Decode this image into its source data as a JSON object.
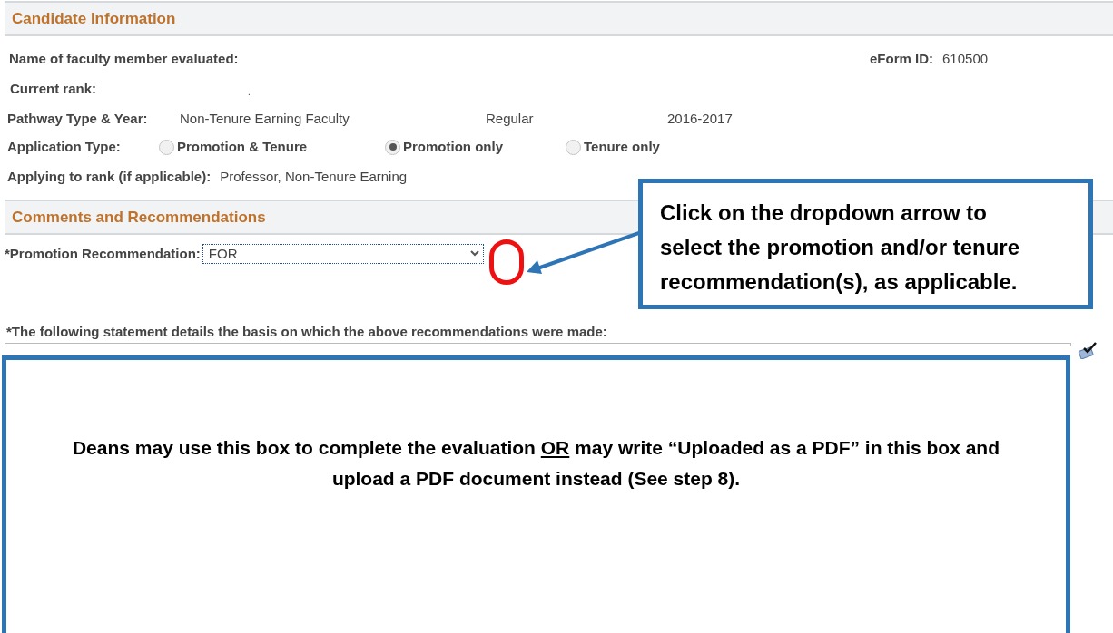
{
  "sections": [
    {
      "title": "Candidate Information"
    },
    {
      "title": "Comments and Recommendations"
    }
  ],
  "candidate": {
    "name_label": "Name of faculty member evaluated:",
    "eform_label": "eForm ID:",
    "eform_value": "610500",
    "rank_label": "Current rank:",
    "rank_value": ".",
    "pathway_label": "Pathway Type & Year:",
    "pathway_values": [
      "Non-Tenure Earning Faculty",
      "Regular",
      "2016-2017"
    ],
    "application_label": "Application Type:",
    "application_options": [
      {
        "label": "Promotion & Tenure",
        "selected": false
      },
      {
        "label": "Promotion only",
        "selected": true
      },
      {
        "label": "Tenure only",
        "selected": false
      }
    ],
    "applying_label": "Applying to rank (if applicable):",
    "applying_value": "Professor, Non-Tenure Earning"
  },
  "recommendation": {
    "label": "*Promotion Recommendation:",
    "value": "FOR",
    "statement_label": "*The following statement details the basis on which the above recommendations were made:"
  },
  "callouts": [
    {
      "kind": "arrow",
      "text": "Click on the dropdown arrow to select the promotion and/or tenure recommendation(s), as applicable."
    },
    {
      "kind": "box",
      "before": "Deans may use this box to complete the evaluation ",
      "underlined": "OR",
      "after": " may write “Uploaded as a PDF” in this box and upload a PDF document instead (See step 8)."
    }
  ]
}
